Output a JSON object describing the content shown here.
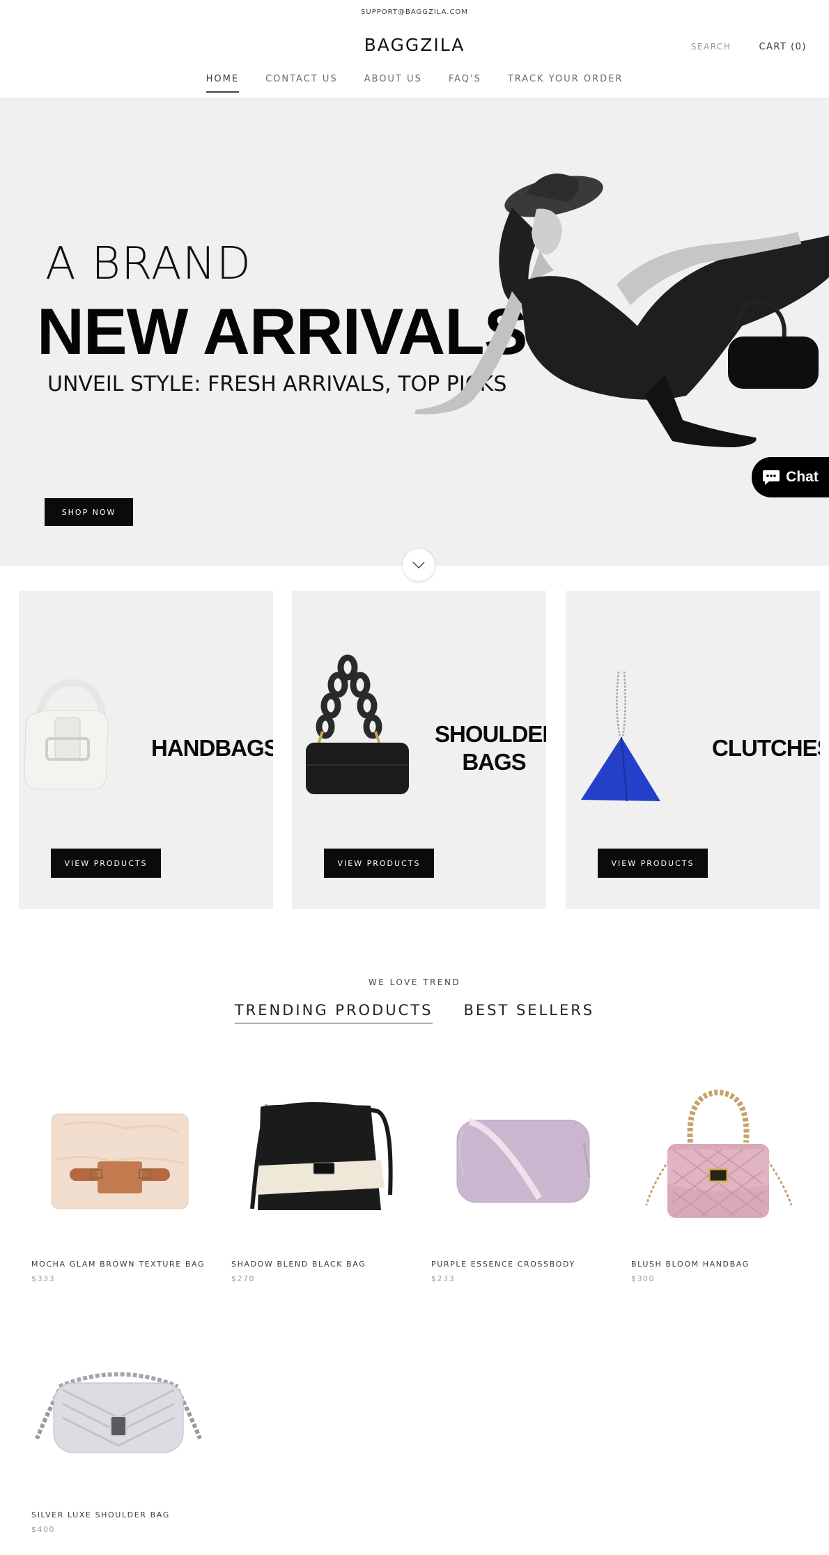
{
  "announcement": "SUPPORT@BAGGZILA.COM",
  "header": {
    "logo": "BAGGZILA",
    "search_label": "SEARCH",
    "cart_label": "CART (0)"
  },
  "nav": {
    "items": [
      {
        "label": "HOME",
        "active": true
      },
      {
        "label": "CONTACT US"
      },
      {
        "label": "ABOUT US"
      },
      {
        "label": "FAQ'S"
      },
      {
        "label": "TRACK YOUR ORDER"
      }
    ]
  },
  "hero": {
    "line1": "A BRAND",
    "line2": "NEW ARRIVALS",
    "line3": "UNVEIL STYLE: FRESH ARRIVALS, TOP PICKS",
    "button": "SHOP NOW"
  },
  "chat": {
    "label": "Chat"
  },
  "categories": [
    {
      "title_line1": "HANDBAGS",
      "title_line2": "",
      "button": "VIEW PRODUCTS"
    },
    {
      "title_line1": "SHOULDER",
      "title_line2": "BAGS",
      "button": "VIEW PRODUCTS"
    },
    {
      "title_line1": "CLUTCHES",
      "title_line2": "",
      "button": "VIEW PRODUCTS"
    }
  ],
  "trending": {
    "eyebrow": "WE LOVE TREND",
    "tabs": [
      {
        "label": "TRENDING PRODUCTS",
        "active": true
      },
      {
        "label": "BEST SELLERS"
      }
    ],
    "products": [
      {
        "name": "MOCHA GLAM BROWN TEXTURE BAG",
        "price": "$333"
      },
      {
        "name": "SHADOW BLEND BLACK BAG",
        "price": "$270"
      },
      {
        "name": "PURPLE ESSENCE CROSSBODY",
        "price": "$233"
      },
      {
        "name": "BLUSH BLOOM HANDBAG",
        "price": "$300"
      },
      {
        "name": "SILVER LUXE SHOULDER BAG",
        "price": "$400"
      }
    ]
  },
  "colors": {
    "accent_black": "#0b0b0b",
    "hero_background": "#f0f0f0",
    "card_background": "#f0f0f0",
    "muted_text": "#9b9b9b"
  }
}
